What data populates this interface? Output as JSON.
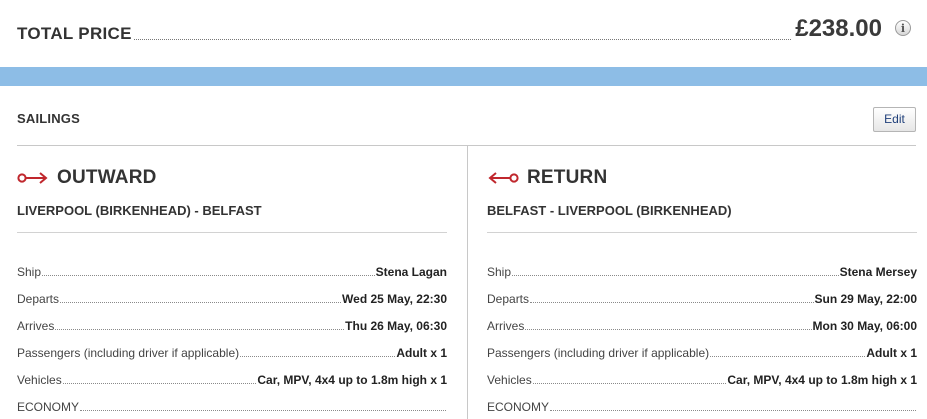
{
  "summary": {
    "total_label": "TOTAL PRICE",
    "total_price": "£238.00",
    "info_icon": "i"
  },
  "sailings": {
    "label": "SAILINGS",
    "edit_label": "Edit"
  },
  "outward": {
    "title": "OUTWARD",
    "route": "LIVERPOOL (BIRKENHEAD) - BELFAST",
    "rows": [
      {
        "label": "Ship",
        "value": "Stena Lagan"
      },
      {
        "label": "Departs",
        "value": "Wed 25 May, 22:30"
      },
      {
        "label": "Arrives",
        "value": "Thu 26 May, 06:30"
      },
      {
        "label": "Passengers (including driver if applicable)",
        "value": "Adult x 1"
      },
      {
        "label": "Vehicles",
        "value": "Car, MPV, 4x4 up to 1.8m high x 1"
      },
      {
        "label": "ECONOMY",
        "value": ""
      }
    ]
  },
  "return": {
    "title": "RETURN",
    "route": "BELFAST - LIVERPOOL (BIRKENHEAD)",
    "rows": [
      {
        "label": "Ship",
        "value": "Stena Mersey"
      },
      {
        "label": "Departs",
        "value": "Sun 29 May, 22:00"
      },
      {
        "label": "Arrives",
        "value": "Mon 30 May, 06:00"
      },
      {
        "label": "Passengers (including driver if applicable)",
        "value": "Adult x 1"
      },
      {
        "label": "Vehicles",
        "value": "Car, MPV, 4x4 up to 1.8m high x 1"
      },
      {
        "label": "ECONOMY",
        "value": ""
      }
    ]
  },
  "colors": {
    "band": "#8dbde6",
    "arrow": "#c0272d",
    "edit_text": "#1f3f7a"
  },
  "icons": {
    "outward": "arrow-right-icon",
    "return": "arrow-left-icon",
    "info": "info-icon"
  }
}
